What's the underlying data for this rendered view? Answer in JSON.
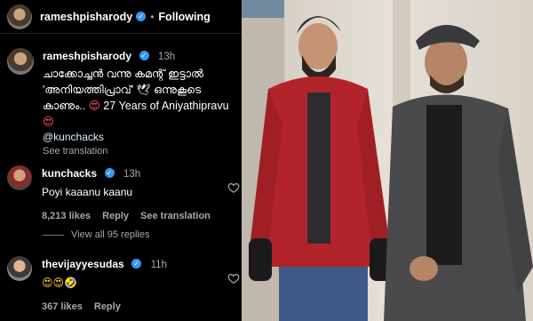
{
  "header": {
    "username": "rameshpisharody",
    "verified_mark": "✓",
    "separator": "•",
    "follow_status": "Following"
  },
  "caption": {
    "username": "rameshpisharody",
    "time": "13h",
    "text_line1": "ചാക്കോച്ചൻ വന്നു കമന്റ് ഇട്ടാൽ 'അനിയത്തിപ്രാവ്' 🕊 ഒന്നുകൂടെ കാണും..",
    "text_line2": "27 Years of Aniyathipravu",
    "emoji": "😍",
    "mention": "@kunchacks",
    "see_translation": "See translation"
  },
  "comments": [
    {
      "username": "kunchacks",
      "time": "13h",
      "text": "Poyi kaaanu kaanu",
      "likes": "8,213 likes",
      "reply": "Reply",
      "see_translation": "See translation"
    },
    {
      "username": "thevijayyesudas",
      "time": "11h",
      "text": "😍😍🤣",
      "likes": "367 likes",
      "reply": "Reply"
    }
  ],
  "view_replies": "View all 95 replies",
  "icons": {
    "heart": "heart-outline-icon",
    "verified": "verified-badge-icon"
  },
  "colors": {
    "verified": "#3897f0",
    "meta_text": "#a8a8a8",
    "background": "#000000"
  }
}
